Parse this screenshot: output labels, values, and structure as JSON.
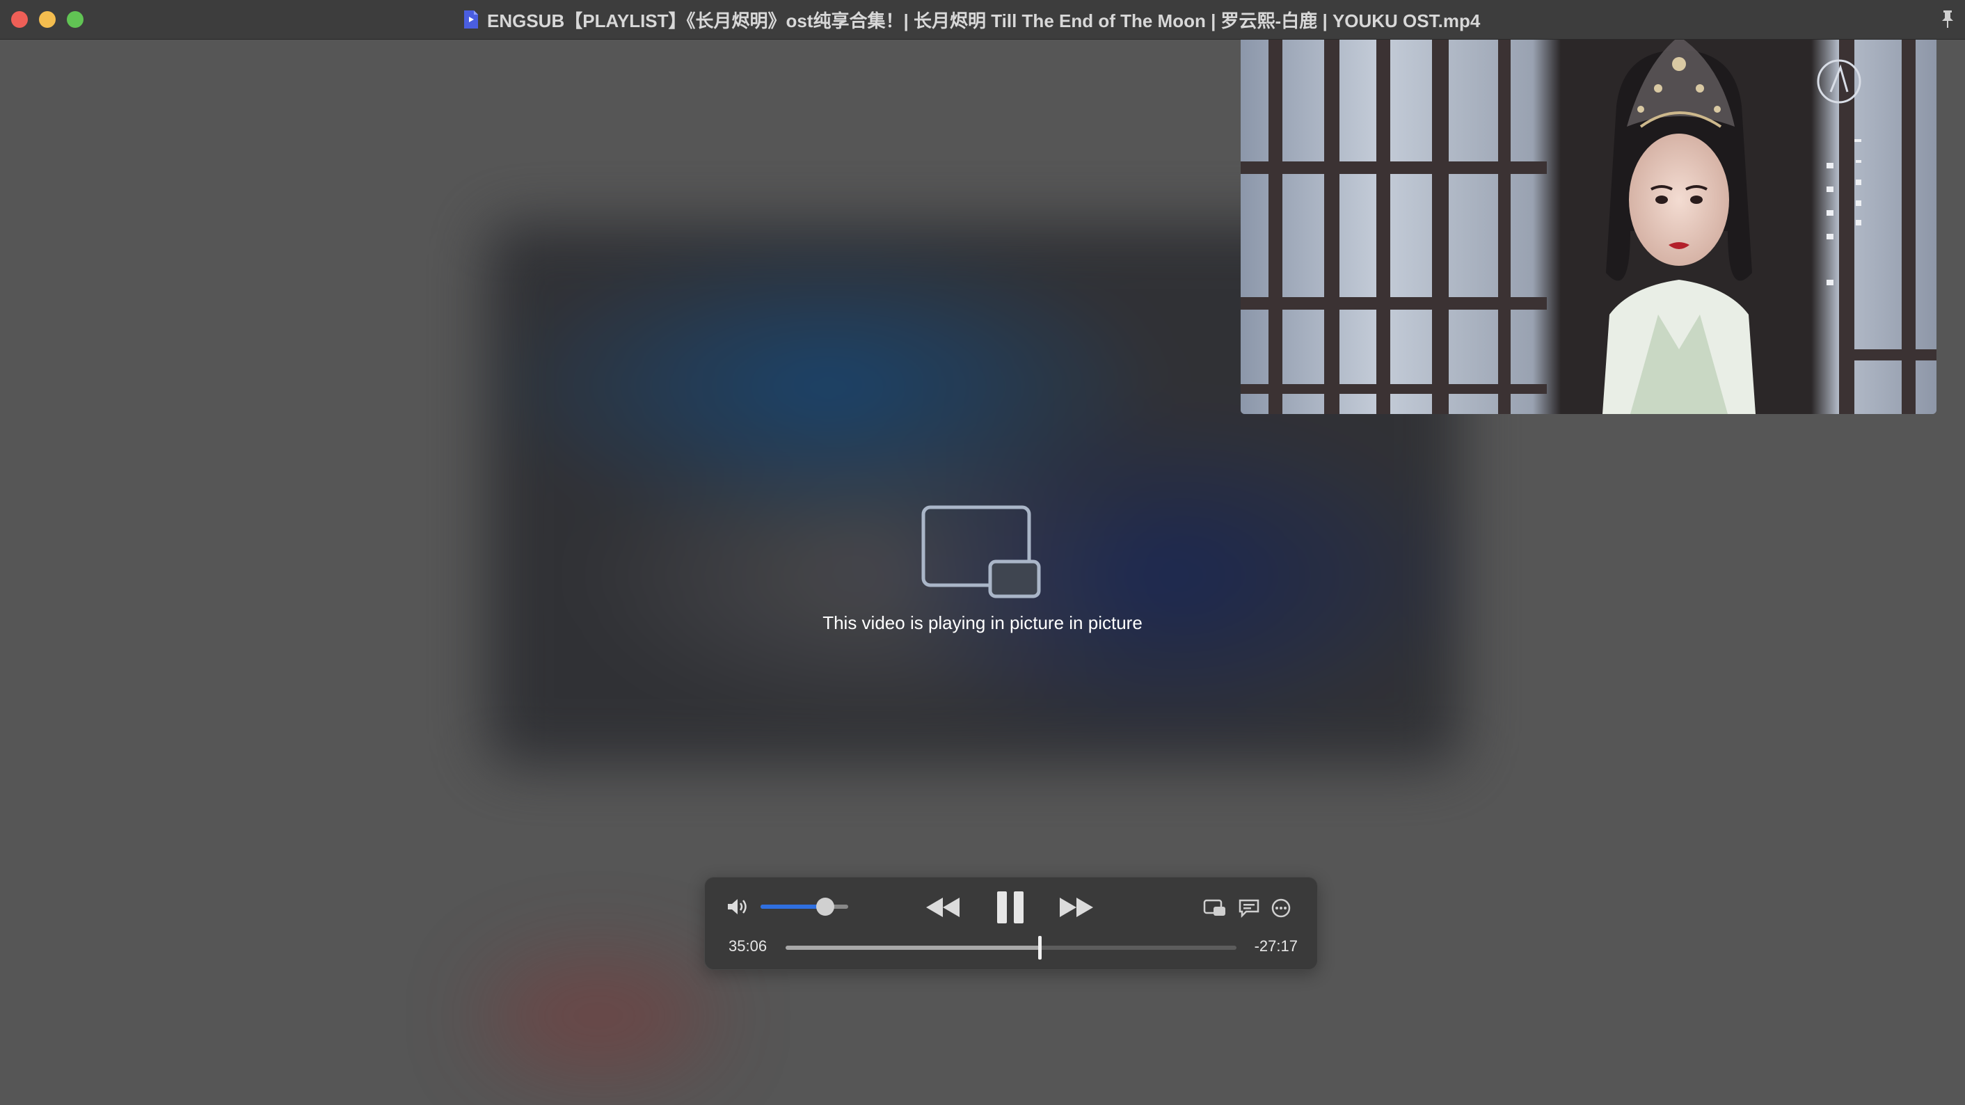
{
  "window": {
    "title": "ENGSUB【PLAYLIST】《长月烬明》ost纯享合集！| 长月烬明 Till The End of The Moon | 罗云熙-白鹿 | YOUKU OST.mp4",
    "doc_icon": "quicktime-doc-icon",
    "pin_icon": "pin-icon"
  },
  "main": {
    "pip_message": "This video is playing in picture in picture",
    "pip_icon": "picture-in-picture-icon"
  },
  "controls": {
    "time_elapsed": "35:06",
    "time_remaining": "-27:17",
    "volume_level": 0.74,
    "playback_progress": 0.563,
    "icons": {
      "volume": "speaker-icon",
      "rewind": "rewind-icon",
      "pause": "pause-icon",
      "fast_forward": "fast-forward-icon",
      "airplay": "airplay-icon",
      "subtitles": "subtitles-icon",
      "more": "more-options-icon"
    }
  },
  "colors": {
    "volume_accent": "#2f6fe0",
    "close": "#ee5f57",
    "minimize": "#f4bd4f",
    "maximize": "#61c454"
  }
}
